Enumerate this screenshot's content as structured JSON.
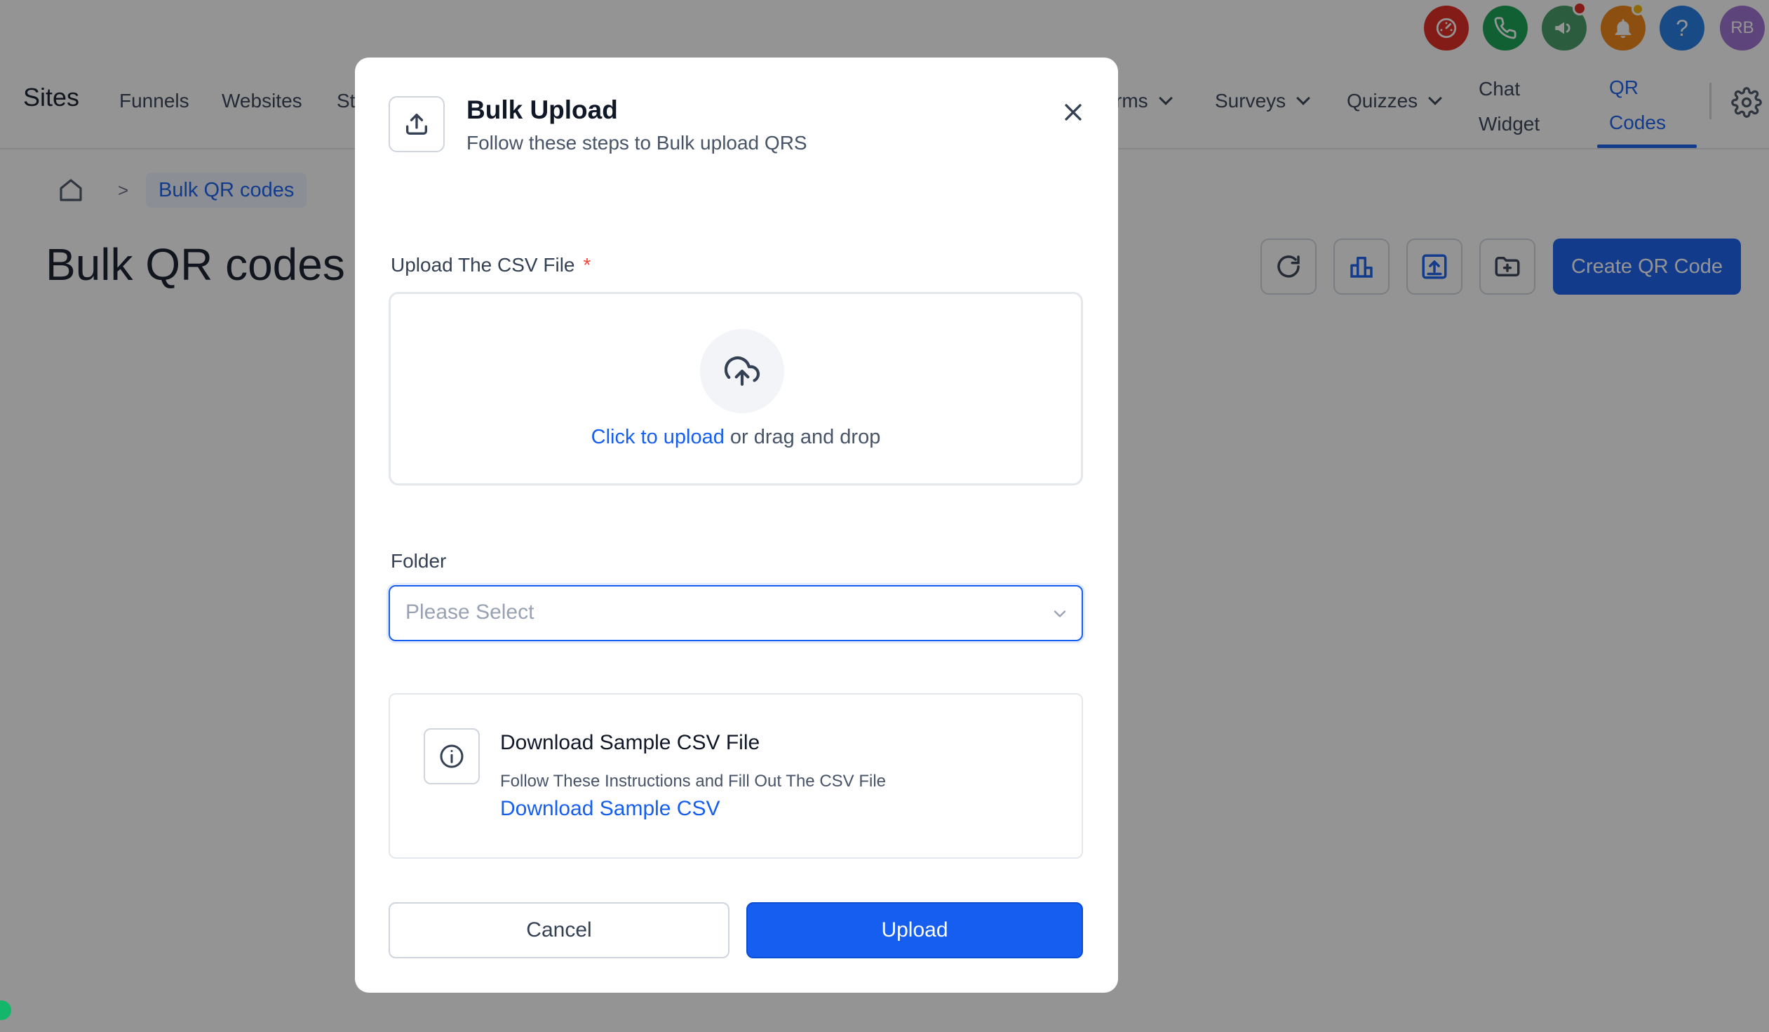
{
  "header": {
    "brand": "Sites",
    "nav": [
      {
        "label": "Funnels"
      },
      {
        "label": "Websites"
      },
      {
        "label": "St"
      },
      {
        "label": "rms"
      },
      {
        "label": "Surveys"
      },
      {
        "label": "Quizzes"
      }
    ],
    "chat_widget_line1": "Chat",
    "chat_widget_line2": "Widget",
    "qr_codes_line1": "QR",
    "qr_codes_line2": "Codes",
    "avatar_initials": "RB",
    "header_icons": [
      "speedometer-icon",
      "phone-icon",
      "megaphone-icon",
      "bell-icon",
      "help-icon"
    ],
    "help_label": "?",
    "colors": {
      "speedometer": "#e1241a",
      "phone": "#12a150",
      "megaphone": "#3e9a62",
      "bell": "#f2820f",
      "help": "#1e7ae6",
      "avatar": "#9b6fd1",
      "accent": "#155eef"
    }
  },
  "breadcrumb": {
    "separator": ">",
    "current": "Bulk QR codes"
  },
  "page": {
    "title": "Bulk QR codes",
    "create_button": "Create QR Code"
  },
  "modal": {
    "title": "Bulk Upload",
    "subtitle": "Follow these steps to Bulk upload QRS",
    "upload_label": "Upload The CSV File",
    "required_mark": "*",
    "dropzone_link": "Click to upload",
    "dropzone_text": " or drag and drop",
    "folder_label": "Folder",
    "folder_placeholder": "Please Select",
    "info_title": "Download Sample CSV File",
    "info_desc": "Follow These Instructions and Fill Out The CSV File",
    "info_link": "Download Sample CSV",
    "cancel_label": "Cancel",
    "upload_button_label": "Upload"
  }
}
